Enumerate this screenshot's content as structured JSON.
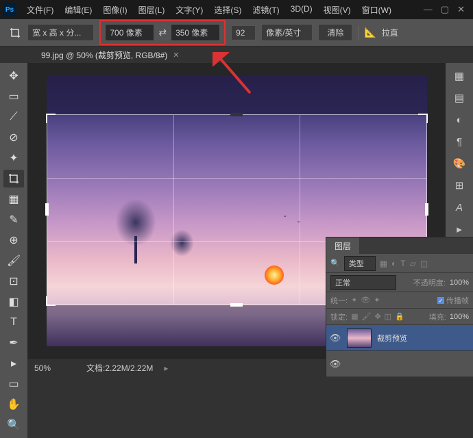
{
  "app": {
    "icon": "Ps"
  },
  "menu": [
    "文件(F)",
    "编辑(E)",
    "图像(I)",
    "图层(L)",
    "文字(Y)",
    "选择(S)",
    "滤镜(T)",
    "3D(D)",
    "视图(V)",
    "窗口(W)"
  ],
  "options": {
    "preset": "宽 x 高 x 分...",
    "width": "700 像素",
    "height": "350 像素",
    "resolution": "92",
    "unit": "像素/英寸",
    "clear": "清除",
    "straighten": "拉直"
  },
  "doc_tab": {
    "title": "99.jpg @ 50% (裁剪预览, RGB/8#)"
  },
  "layers_panel": {
    "tab": "图层",
    "filter_kind": "类型",
    "blend_mode": "正常",
    "opacity_label": "不透明度:",
    "opacity_value": "100%",
    "unify_label": "统一:",
    "propagate": "传播帧",
    "lock_label": "锁定:",
    "fill_label": "填充:",
    "fill_value": "100%",
    "layers": [
      {
        "name": "裁剪预览"
      },
      {
        "name": ""
      }
    ]
  },
  "status": {
    "zoom": "50%",
    "doc_info": "文档:2.22M/2.22M"
  },
  "highlight": {
    "color": "#d93333"
  }
}
